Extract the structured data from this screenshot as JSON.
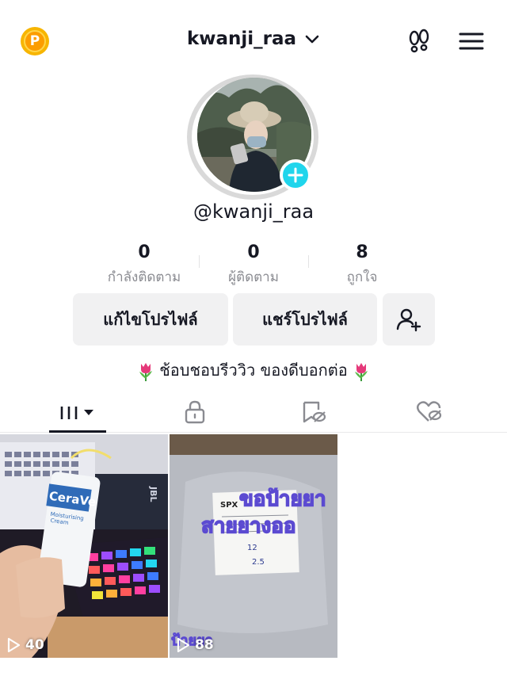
{
  "header": {
    "points_icon": "points-coin-icon",
    "points_letter": "P",
    "username": "kwanji_raa",
    "icons": [
      "chevron-down-icon",
      "footprint-icon",
      "hamburger-menu-icon"
    ]
  },
  "profile": {
    "handle": "@kwanji_raa",
    "stats": [
      {
        "value": "0",
        "label": "กำลังติดตาม"
      },
      {
        "value": "0",
        "label": "ผู้ติดตาม"
      },
      {
        "value": "8",
        "label": "ถูกใจ"
      }
    ],
    "buttons": {
      "edit": "แก้ไขโปรไฟล์",
      "share": "แชร์โปรไฟล์"
    },
    "bio": "ช้อบชอบรีววิว ของดีบอกต่อ"
  },
  "tabs": [
    "videos-grid-icon",
    "lock-icon",
    "bookmark-icon",
    "liked-heart-icon"
  ],
  "videos": [
    {
      "views": "40",
      "overlay_text": "",
      "brand": "CeraVe",
      "product": "Moisturising Cream"
    },
    {
      "views": "88",
      "overlay_text": "ขอป้ายยา สายยางออ",
      "bottom_text": "ป้ายยา",
      "label_lines": [
        "SPX",
        "12",
        "2.5"
      ]
    }
  ],
  "colors": {
    "accent": "#20d5ec",
    "text": "#161823",
    "secondary": "#8a8b91",
    "button_bg": "#f1f1f2",
    "coin": "#f7b500"
  }
}
